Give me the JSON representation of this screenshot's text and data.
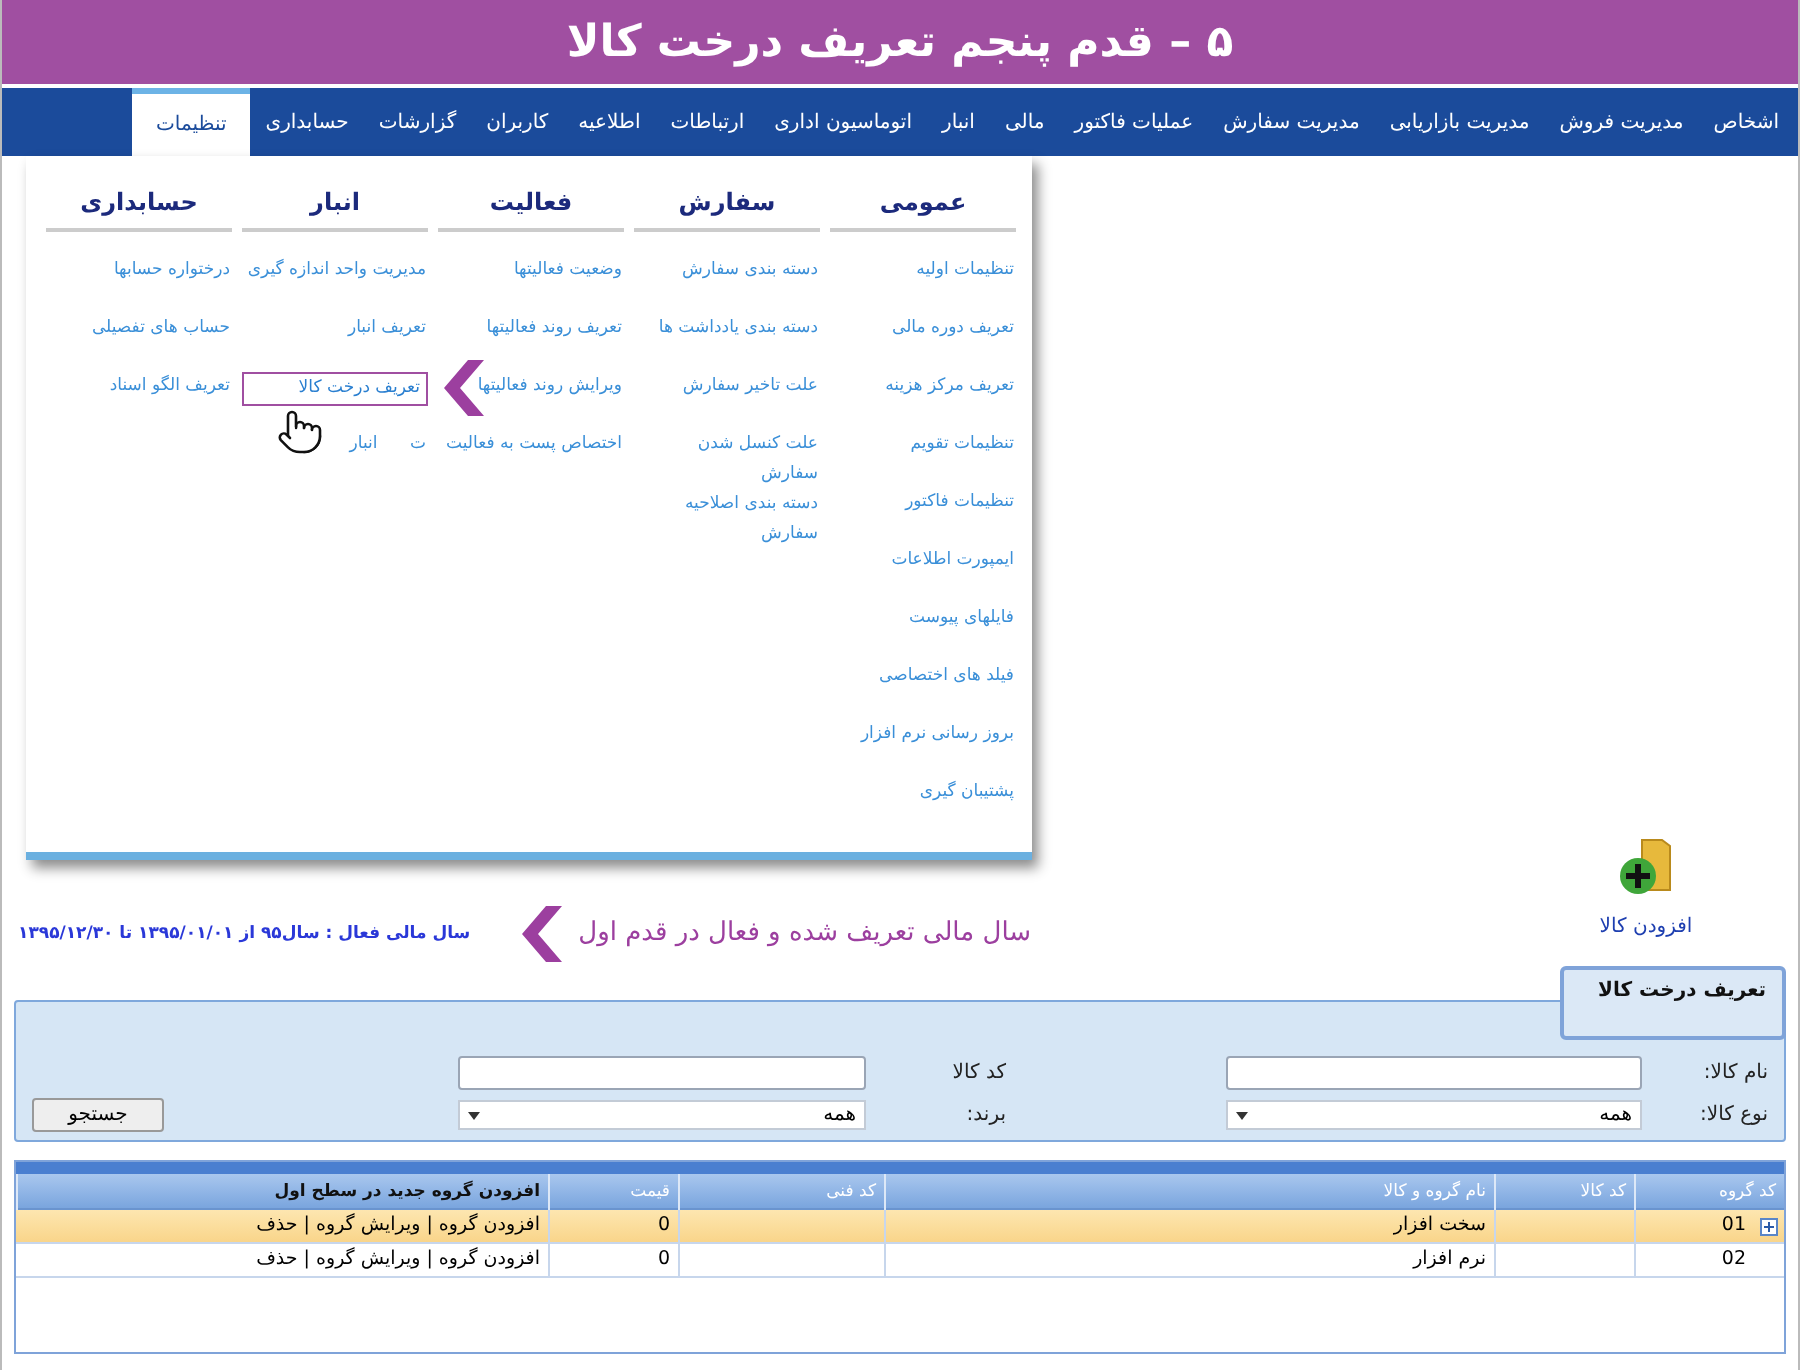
{
  "title": "۵ – قدم  پنجم تعریف درخت کالا",
  "nav": [
    {
      "label": "اشخاص",
      "selected": false
    },
    {
      "label": "مدیریت فروش",
      "selected": false
    },
    {
      "label": "مدیریت بازاریابی",
      "selected": false
    },
    {
      "label": "مدیریت سفارش",
      "selected": false
    },
    {
      "label": "عملیات فاکتور",
      "selected": false
    },
    {
      "label": "مالی",
      "selected": false
    },
    {
      "label": "انبار",
      "selected": false
    },
    {
      "label": "اتوماسیون اداری",
      "selected": false
    },
    {
      "label": "ارتباطات",
      "selected": false
    },
    {
      "label": "اطلاعیه",
      "selected": false
    },
    {
      "label": "کاربران",
      "selected": false
    },
    {
      "label": "گزارشات",
      "selected": false
    },
    {
      "label": "حسابداری",
      "selected": false
    },
    {
      "label": "تنظیمات",
      "selected": true
    }
  ],
  "menu": {
    "columns": [
      {
        "heading": "عمومی",
        "items": [
          {
            "label": "تنظیمات اولیه",
            "selected": false
          },
          {
            "label": "تعریف دوره مالی",
            "selected": false
          },
          {
            "label": "تعریف مرکز هزینه",
            "selected": false
          },
          {
            "label": "تنظیمات تقویم",
            "selected": false
          },
          {
            "label": "تنظیمات فاکتور",
            "selected": false
          },
          {
            "label": "ایمپورت اطلاعات",
            "selected": false
          },
          {
            "label": "فایلهای پیوست",
            "selected": false
          },
          {
            "label": "فیلد های اختصاصی",
            "selected": false
          },
          {
            "label": "بروز رسانی نرم افزار",
            "selected": false
          },
          {
            "label": "پشتیبان گیری",
            "selected": false
          }
        ]
      },
      {
        "heading": "سفارش",
        "items": [
          {
            "label": "دسته بندی سفارش",
            "selected": false
          },
          {
            "label": "دسته بندی یادداشت ها",
            "selected": false
          },
          {
            "label": "علت تاخیر سفارش",
            "selected": false
          },
          {
            "label": "علت کنسل شدن سفارش",
            "selected": false
          },
          {
            "label": "دسته بندی اصلاحیه سفارش",
            "selected": false
          }
        ]
      },
      {
        "heading": "فعالیت",
        "items": [
          {
            "label": "وضعیت فعالیتها",
            "selected": false
          },
          {
            "label": "تعریف روند فعالیتها",
            "selected": false
          },
          {
            "label": "ویرایش روند فعالیتها",
            "selected": false
          },
          {
            "label": "اختصاص پست به فعالیت",
            "selected": false
          }
        ]
      },
      {
        "heading": "انبار",
        "items": [
          {
            "label": "مدیریت واحد اندازه گیری",
            "selected": false
          },
          {
            "label": "تعریف انبار",
            "selected": false
          },
          {
            "label": "تعریف درخت کالا",
            "selected": true
          },
          {
            "label": "ت      انبار",
            "selected": false
          }
        ]
      },
      {
        "heading": "حسابداری",
        "items": [
          {
            "label": "درختواره حسابها",
            "selected": false
          },
          {
            "label": "حساب های تفصیلی",
            "selected": false
          },
          {
            "label": "تعریف الگو اسناد",
            "selected": false
          }
        ]
      }
    ]
  },
  "add_button": {
    "label": "افزودن کالا"
  },
  "hint": "سال مالی تعریف شده و فعال در قدم اول",
  "fiscal_year": "سال مالی فعال : سال۹۵ از ۱۳۹۵/۰۱/۰۱ تا ۱۳۹۵/۱۲/۳۰",
  "panel": {
    "title": "تعریف درخت کالا",
    "fields": [
      {
        "label": "نام کالا:",
        "kind": "text"
      },
      {
        "label": "کد کالا",
        "kind": "text"
      },
      {
        "label": "نوع کالا:",
        "kind": "select",
        "value": "همه"
      },
      {
        "label": "برند:",
        "kind": "select",
        "value": "همه"
      }
    ],
    "search_button": "جستجو"
  },
  "table": {
    "columns": [
      "کد گروه",
      "کد کالا",
      "نام گروه و کالا",
      "کد فنی",
      "قیمت",
      "افزودن گروه جدید در سطح اول"
    ],
    "action_separator": "|",
    "rows": [
      {
        "group_code": "01",
        "name": "سخت افزار",
        "price": "0",
        "actions": [
          "افزودن گروه",
          "ویرایش گروه",
          "حذف"
        ],
        "selected": true,
        "expandable": true
      },
      {
        "group_code": "02",
        "name": "نرم افزار",
        "price": "0",
        "actions": [
          "افزودن گروه",
          "ویرایش گروه",
          "حذف"
        ],
        "selected": false,
        "expandable": false
      }
    ]
  }
}
